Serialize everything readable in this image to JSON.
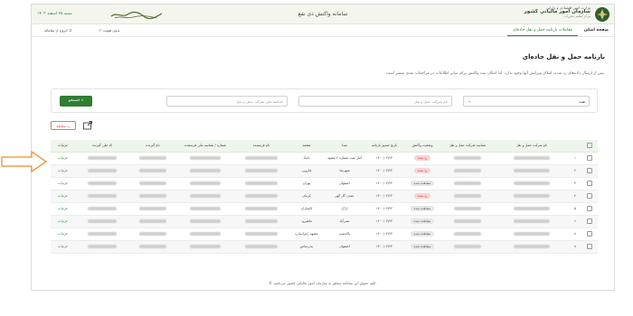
{
  "header": {
    "org_line1": "وزارت امور اقتصادی و دارایی",
    "org_line2": "سازمان امور مالیاتی کشور",
    "org_line3": "مرکز تنظیم مقررات",
    "system_title": "سامانه واکنش ذی نفع",
    "date": "شنبه ۲۵ اسفند ۱۴۰۳"
  },
  "nav": {
    "home": "صفحه اصلی",
    "active_tab": "معاملات بارنامه حمل و نقل جاده‌ای",
    "profile": "بدون هویت",
    "logout": "خروج از سامانه"
  },
  "page": {
    "title": "بارنامه حمل و نقل جاده‌ای",
    "description": "پس از ارسال داده‌های رد شده، امکان ویرایش آنها وجود ندارد. لذا امکان ثبت واکنش برای سایر اطلاعات در مراجعات بعدی میسر است."
  },
  "filters": {
    "select_value": "همه",
    "company_placeholder": "نام شرکت حمل و نقل",
    "national_id_placeholder": "شناسه ملی شرکت حمل و نقل",
    "search_label": "جستجو"
  },
  "actions": {
    "reject_label": "رد معامله"
  },
  "table": {
    "headers": [
      "",
      "",
      "نام شرکت حمل و نقل",
      "شناسه شرکت حمل و نقل",
      "وضعیت واکنش",
      "تاریخ صدور بارنامه",
      "مبدا",
      "مقصد",
      "نام فرستنده",
      "شماره / شناسه ملی فرستنده",
      "نام گیرنده",
      "کد ملی گیرنده",
      "جزئیات"
    ],
    "rows": [
      {
        "num": "۱",
        "status": "رد شده",
        "status_type": "reject",
        "date": "۱۴۰۰/۰۳/۲۴",
        "origin": "آمار نفت شماره ۲ مشهد",
        "destination": "تایباد",
        "details": "جزئیات"
      },
      {
        "num": "۲",
        "status": "رد شده",
        "status_type": "reject",
        "date": "۱۴۰۰/۰۳/۲۴",
        "origin": "شهرضا",
        "destination": "قاروین",
        "details": "جزئیات"
      },
      {
        "num": "۳",
        "status": "مشاهده شده",
        "status_type": "seen",
        "date": "۱۴۰۰/۰۳/۲۴",
        "origin": "اصفهان",
        "destination": "تهران",
        "details": "جزئیات"
      },
      {
        "num": "۴",
        "status": "رد شده",
        "status_type": "reject",
        "date": "۱۴۰۰/۰۳/۲۴",
        "origin": "معدن گل گهر",
        "destination": "کرمان",
        "details": "جزئیات"
      },
      {
        "num": "۵",
        "status": "مشاهده شده",
        "status_type": "seen",
        "date": "۱۴۰۰/۰۳/۲۴",
        "origin": "اراک",
        "destination": "کامیاران",
        "details": "جزئیات"
      },
      {
        "num": "۶",
        "status": "مشاهده شده",
        "status_type": "seen",
        "date": "۱۴۰۰/۰۳/۲۴",
        "origin": "نصرآباد",
        "destination": "ماهیرود",
        "details": "جزئیات"
      },
      {
        "num": "۷",
        "status": "مشاهده شده",
        "status_type": "seen",
        "date": "۱۴۰۰/۰۳/۲۴",
        "origin": "پاکدشت",
        "destination": "مشهد (خراسان)",
        "details": "جزئیات"
      },
      {
        "num": "۸",
        "status": "مشاهده شده",
        "status_type": "seen",
        "date": "۱۴۰۰/۰۳/۲۴",
        "origin": "اصفهان",
        "destination": "بندرعباس",
        "details": "جزئیات"
      }
    ]
  },
  "footer": {
    "text": "© کلیه حقوق این سامانه متعلق به سازمان امور مالیاتی کشور می‌باشد."
  },
  "colors": {
    "brand": "#2e7d32",
    "reject": "#c62828",
    "annotation_arrow": "#f08a24"
  }
}
